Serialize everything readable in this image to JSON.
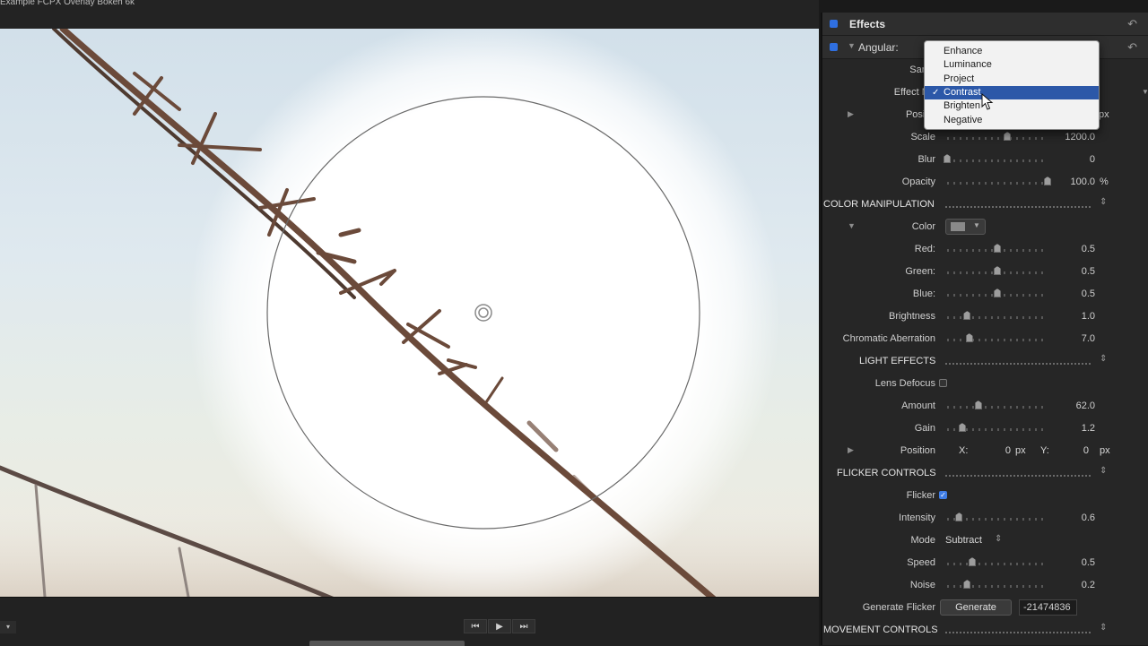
{
  "viewer": {
    "title": "Example FCPX Overlay Bokeh 6k",
    "transport": {
      "prev": "⏮",
      "play": "▶",
      "next": "⏭",
      "left_dropdown": "▾"
    }
  },
  "inspector": {
    "header": {
      "title": "Effects"
    },
    "effect": {
      "name": "Angular:"
    },
    "rows": {
      "samples_label": "Samp",
      "effect_mode_label": "Effect Mo",
      "position_label": "Positio",
      "position_unit": "px",
      "scale": {
        "label": "Scale",
        "value": "1200.0",
        "level": 0.6
      },
      "blur": {
        "label": "Blur",
        "value": "0",
        "level": 0.0
      },
      "opacity": {
        "label": "Opacity",
        "value": "100.0",
        "unit": "%",
        "level": 1.0
      },
      "color_manipulation": "COLOR MANIPULATION",
      "color": {
        "label": "Color",
        "swatch": "#8a8a8a"
      },
      "red": {
        "label": "Red:",
        "value": "0.5",
        "level": 0.5
      },
      "green": {
        "label": "Green:",
        "value": "0.5",
        "level": 0.5
      },
      "blue": {
        "label": "Blue:",
        "value": "0.5",
        "level": 0.5
      },
      "brightness": {
        "label": "Brightness",
        "value": "1.0",
        "level": 0.2
      },
      "chromatic": {
        "label": "Chromatic Aberration",
        "value": "7.0",
        "level": 0.22
      },
      "light_effects": "LIGHT EFFECTS",
      "lens_defocus": {
        "label": "Lens Defocus",
        "checked": false
      },
      "amount": {
        "label": "Amount",
        "value": "62.0",
        "level": 0.31
      },
      "gain": {
        "label": "Gain",
        "value": "1.2",
        "level": 0.15
      },
      "position2": {
        "label": "Position",
        "x_label": "X:",
        "x_value": "0",
        "x_unit": "px",
        "y_label": "Y:",
        "y_value": "0",
        "y_unit": "px"
      },
      "flicker_controls": "FLICKER CONTROLS",
      "flicker": {
        "label": "Flicker",
        "checked": true
      },
      "intensity": {
        "label": "Intensity",
        "value": "0.6",
        "level": 0.12
      },
      "mode": {
        "label": "Mode",
        "value": "Subtract"
      },
      "speed": {
        "label": "Speed",
        "value": "0.5",
        "level": 0.25
      },
      "noise": {
        "label": "Noise",
        "value": "0.2",
        "level": 0.2
      },
      "generate_flicker": {
        "label": "Generate Flicker",
        "button": "Generate",
        "field": "-21474836"
      },
      "movement_controls": "MOVEMENT CONTROLS"
    }
  },
  "mode_menu": {
    "items": [
      "Enhance",
      "Luminance",
      "Project",
      "Contrast",
      "Brighten",
      "Negative"
    ],
    "selected": "Contrast",
    "check": "✓"
  },
  "colors": {
    "accent": "#2f6fe0",
    "menu_selection": "#2c58a8"
  }
}
